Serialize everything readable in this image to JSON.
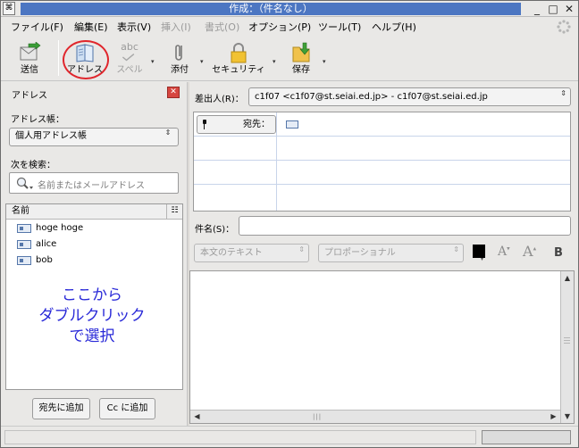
{
  "window": {
    "title": "作成：（件名なし）",
    "app_icon_glyph": "⌘",
    "buttons": {
      "minimize": "_",
      "maximize": "□",
      "close": "✕"
    }
  },
  "menubar": {
    "items": [
      {
        "label": "ファイル(F)",
        "enabled": true
      },
      {
        "label": "編集(E)",
        "enabled": true
      },
      {
        "label": "表示(V)",
        "enabled": true
      },
      {
        "label": "挿入(I)",
        "enabled": false
      },
      {
        "label": "書式(O)",
        "enabled": false
      },
      {
        "label": "オプション(P)",
        "enabled": true
      },
      {
        "label": "ツール(T)",
        "enabled": true
      },
      {
        "label": "ヘルプ(H)",
        "enabled": true
      }
    ]
  },
  "toolbar": {
    "send_label": "送信",
    "address_label": "アドレス",
    "spell_label": "スペル",
    "spell_icon_text": "abc",
    "attach_label": "添付",
    "security_label": "セキュリティ",
    "save_label": "保存",
    "dropdown_arrow": "▾"
  },
  "address_pane": {
    "title": "アドレス",
    "close_glyph": "✕",
    "book_label": "アドレス帳：",
    "book_value": "個人用アドレス帳",
    "search_label": "次を検索：",
    "search_placeholder": "名前またはメールアドレス",
    "column_header": "名前",
    "contacts": [
      "hoge hoge",
      "alice",
      "bob"
    ],
    "hint": "ここから\nダブルクリック\nで選択",
    "add_to_button": "宛先に追加",
    "add_cc_button": "Cc に追加"
  },
  "compose": {
    "from_label": "差出人(R)：",
    "from_value": "c1f07 <c1f07@st.seiai.ed.jp>   - c1f07@st.seiai.ed.jp",
    "to_label": "宛先：",
    "subject_label": "件名(S)：",
    "subject_value": "",
    "paragraph_style": "本文のテキスト",
    "font_family": "プロポーショナル",
    "text_color": "#000000",
    "bold_label": "B"
  },
  "icons": {
    "combo_arrows": "⇕"
  }
}
